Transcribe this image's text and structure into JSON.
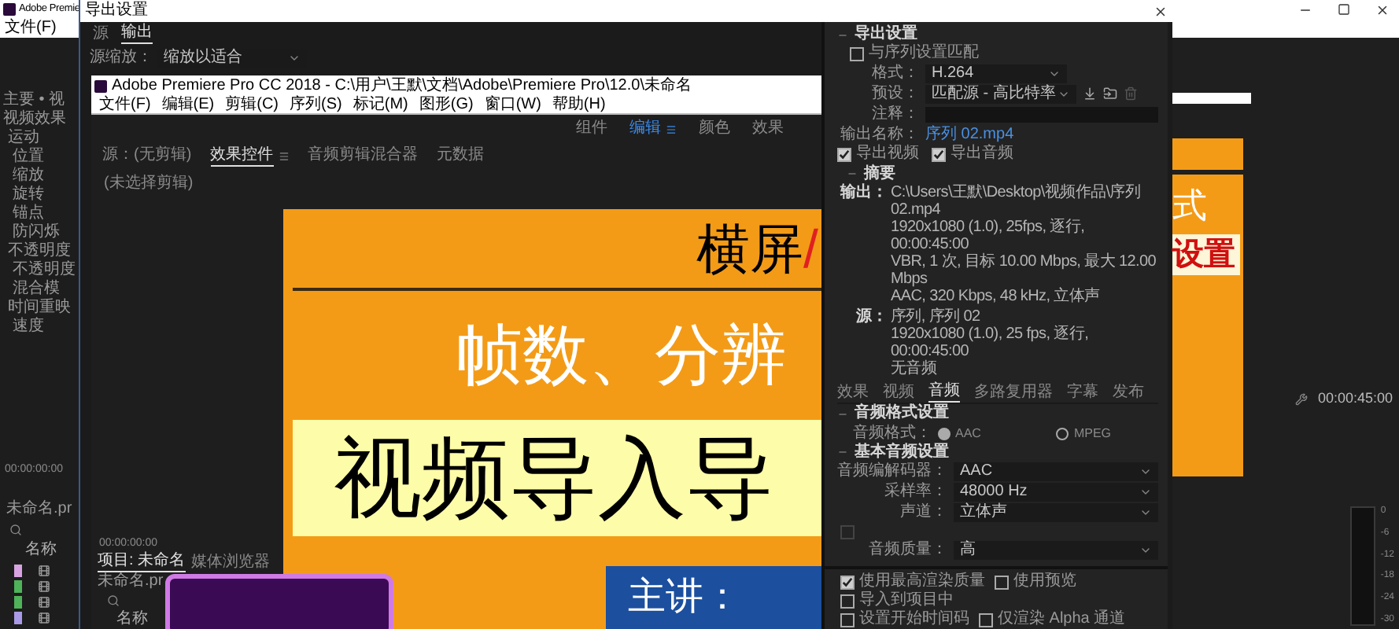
{
  "app": {
    "title": "Adobe Premie",
    "menu": [
      "文件(F)"
    ],
    "effects": {
      "header": "主要 • 视",
      "tree": [
        {
          "label": "视频效果",
          "children": [
            {
              "label": "运动",
              "children": [
                {
                  "label": "位置"
                },
                {
                  "label": "缩放"
                },
                {
                  "label": "旋转"
                },
                {
                  "label": "锚点"
                },
                {
                  "label": "防闪烁"
                }
              ]
            },
            {
              "label": "不透明度",
              "children": [
                {
                  "label": "不透明度"
                },
                {
                  "label": "混合模"
                }
              ]
            },
            {
              "label": "时间重映",
              "children": [
                {
                  "label": "速度"
                }
              ]
            }
          ]
        }
      ]
    },
    "timecode": "00:00:00:00",
    "project_file": "未命名.pr",
    "name_column": "名称",
    "clips": [
      {
        "color": "#d7a3e0"
      },
      {
        "color": "#4fb35a"
      },
      {
        "color": "#4fb35a"
      },
      {
        "color": "#a89ae6"
      }
    ],
    "program_timecode": "00:00:45:00",
    "meter_scale": [
      "0",
      "-6",
      "-12",
      "-18",
      "-24",
      "-30"
    ]
  },
  "dialog": {
    "title": "导出设置",
    "tabs": [
      {
        "label": "源",
        "selected": false
      },
      {
        "label": "输出",
        "selected": true
      }
    ],
    "source_scale": {
      "label": "源缩放：",
      "value": "缩放以适合"
    }
  },
  "embedded_window": {
    "title": "Adobe Premiere Pro CC 2018 - C:\\用户\\王默\\文档\\Adobe\\Premiere Pro\\12.0\\未命名",
    "menu": [
      "文件(F)",
      "编辑(E)",
      "剪辑(C)",
      "序列(S)",
      "标记(M)",
      "图形(G)",
      "窗口(W)",
      "帮助(H)"
    ],
    "workspaces": [
      {
        "label": "组件",
        "selected": false
      },
      {
        "label": "编辑",
        "selected": true
      },
      {
        "label": "颜色",
        "selected": false
      },
      {
        "label": "效果",
        "selected": false
      }
    ],
    "panel_tabs": [
      {
        "label": "源：(无剪辑)",
        "selected": false
      },
      {
        "label": "效果控件",
        "selected": true
      },
      {
        "label": "音频剪辑混合器",
        "selected": false
      },
      {
        "label": "元数据",
        "selected": false
      }
    ],
    "empty_message": "(未选择剪辑)",
    "timecode": "00:00:00:00",
    "project_tabs": [
      {
        "label": "项目: 未命名",
        "selected": true
      },
      {
        "label": "媒体浏览器",
        "selected": false
      }
    ],
    "project_file": "未命名.pr",
    "name_column": "名称"
  },
  "slide": {
    "title": "横屏",
    "title_suffix": "/",
    "line_1": "帧数、分辨",
    "line_2": "视频导入导",
    "presenter": "主讲：",
    "right_line_1": "式",
    "right_line_2": "设置"
  },
  "export_panel": {
    "section": "导出设置",
    "match_sequence": {
      "label": "与序列设置匹配",
      "checked": false
    },
    "fields": [
      {
        "kind": "dropdown",
        "label": "格式：",
        "value": "H.264"
      },
      {
        "kind": "preset",
        "label": "预设：",
        "value": "匹配源 - 高比特率"
      },
      {
        "kind": "text",
        "label": "注释："
      },
      {
        "kind": "link",
        "label": "输出名称：",
        "value": "序列 02.mp4"
      }
    ],
    "exports": [
      {
        "label": "导出视频",
        "checked": true
      },
      {
        "label": "导出音频",
        "checked": true
      }
    ],
    "summary": {
      "title": "摘要",
      "output_label": "输出：",
      "output_lines": [
        "C:\\Users\\王默\\Desktop\\视频作品\\序列 02.mp4",
        "1920x1080 (1.0), 25fps, 逐行, 00:00:45:00",
        "VBR, 1 次, 目标 10.00 Mbps, 最大 12.00 Mbps",
        "AAC, 320 Kbps, 48 kHz, 立体声"
      ],
      "source_label": "源：",
      "source_lines": [
        "序列, 序列 02",
        "1920x1080 (1.0), 25 fps, 逐行, 00:00:45:00",
        "无音频"
      ]
    },
    "tabs": [
      {
        "label": "效果",
        "selected": false
      },
      {
        "label": "视频",
        "selected": false
      },
      {
        "label": "音频",
        "selected": true
      },
      {
        "label": "多路复用器",
        "selected": false
      },
      {
        "label": "字幕",
        "selected": false
      },
      {
        "label": "发布",
        "selected": false
      }
    ],
    "audio_format": {
      "title": "音频格式设置",
      "label": "音频格式：",
      "options": [
        {
          "label": "AAC",
          "selected": true
        },
        {
          "label": "MPEG",
          "selected": false
        }
      ]
    },
    "basic_audio": {
      "title": "基本音频设置",
      "fields": [
        {
          "label": "音频编解码器：",
          "value": "AAC"
        },
        {
          "label": "采样率：",
          "value": "48000 Hz"
        },
        {
          "label": "声道：",
          "value": "立体声"
        }
      ],
      "bit_depth": {
        "checked": false,
        "disabled": true
      },
      "quality": {
        "label": "音频质量：",
        "value": "高"
      }
    },
    "option_rows": [
      [
        {
          "label": "使用最高渲染质量",
          "checked": true
        },
        {
          "label": "使用预览",
          "checked": false
        }
      ],
      [
        {
          "label": "导入到项目中",
          "checked": false
        }
      ],
      [
        {
          "label": "设置开始时间码",
          "checked": false
        },
        {
          "label": "仅渲染 Alpha 通道",
          "checked": false
        }
      ]
    ]
  }
}
